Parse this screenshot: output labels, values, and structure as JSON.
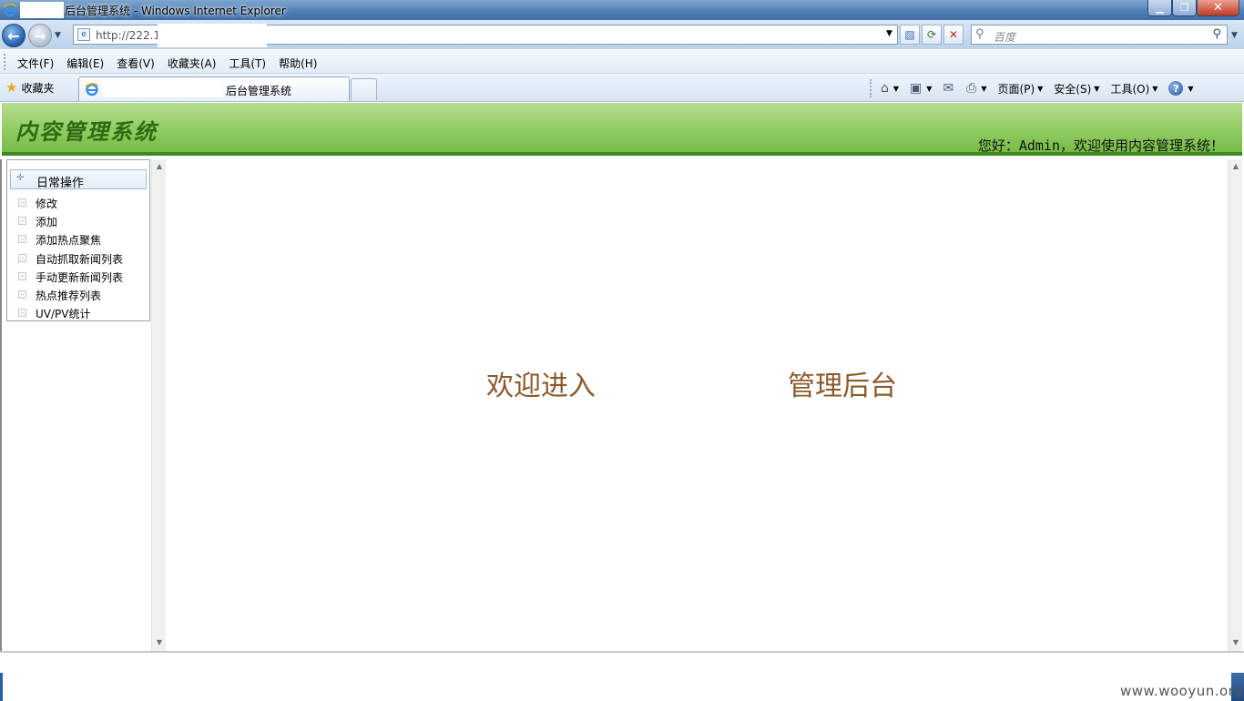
{
  "window": {
    "title": "后台管理系统 - Windows Internet Explorer",
    "min_glyph": "▁",
    "max_glyph": "❐",
    "close_glyph": "✕"
  },
  "address": {
    "url": "http://222.1",
    "search_placeholder": "百度"
  },
  "menubar": {
    "items": [
      "文件(F)",
      "编辑(E)",
      "查看(V)",
      "收藏夹(A)",
      "工具(T)",
      "帮助(H)"
    ]
  },
  "favbar": {
    "favorites_label": "收藏夹",
    "tab_title": "后台管理系统",
    "page_label": "页面(P)",
    "safety_label": "安全(S)",
    "tools_label": "工具(O)"
  },
  "icons": {
    "ie": "ie-icon",
    "back": "back-arrow-icon",
    "forward": "forward-arrow-icon",
    "compat": "compatibility-view-icon",
    "refresh": "refresh-icon",
    "stop": "stop-icon",
    "search": "search-icon",
    "star": "star-icon",
    "home": "home-icon",
    "feed": "rss-feed-icon",
    "mail": "mail-icon",
    "print": "printer-icon",
    "help": "help-icon"
  },
  "site": {
    "title": "内容管理系统",
    "welcome_user": "您好：Admin，欢迎使用内容管理系统！"
  },
  "sidebar": {
    "header": "日常操作",
    "items": [
      "修改",
      "添加",
      "添加热点聚焦",
      "自动抓取新闻列表",
      "手动更新新闻列表",
      "热点推荐列表",
      "UV/PV统计"
    ]
  },
  "main": {
    "welcome_part1": "欢迎进入",
    "welcome_part2": "管理后台"
  },
  "watermark": "www.wooyun.org",
  "colors": {
    "header_green": "#90cc62",
    "header_border": "#3f8a1f",
    "site_title": "#2f6a12",
    "welcome_text": "#8b5a2b"
  }
}
